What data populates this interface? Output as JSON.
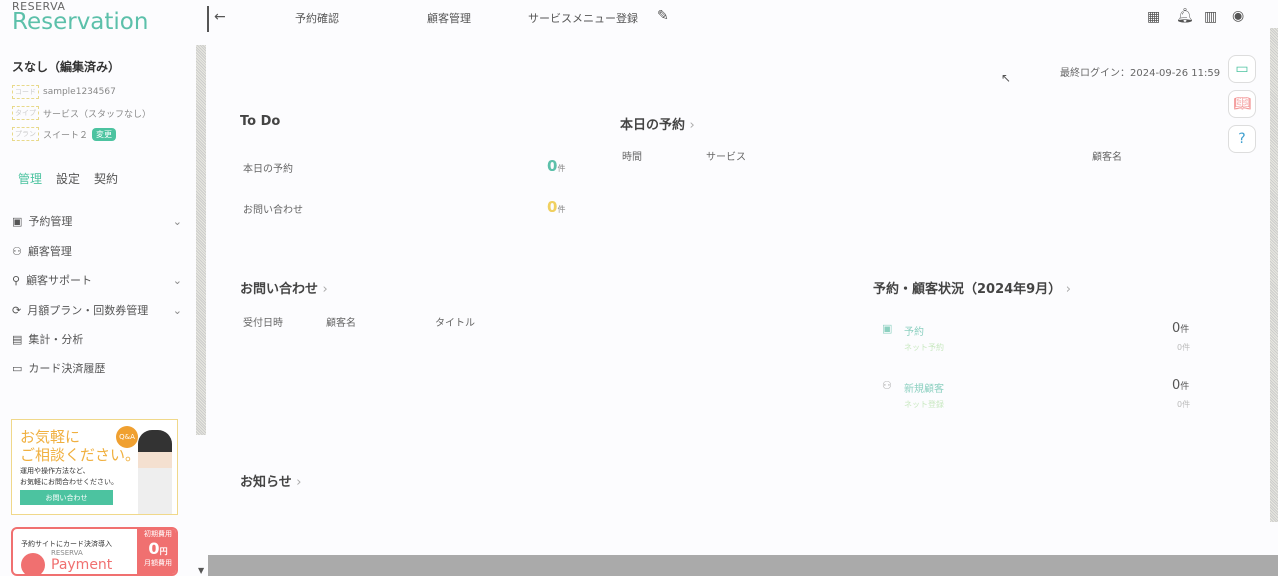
{
  "logo": {
    "brand": "RESERVA",
    "product": "Reservation"
  },
  "shop": {
    "name": "スなし（編集済み）",
    "code_tag": "コード",
    "code": "sample1234567",
    "type_tag": "タイプ",
    "type": "サービス（スタッフなし）",
    "plan_tag": "プラン",
    "plan": "スイート２",
    "change": "変更"
  },
  "sidebar": {
    "tabs": [
      "管理",
      "設定",
      "契約"
    ],
    "items": [
      {
        "label": "予約管理",
        "icon": "calendar-icon",
        "expand": true
      },
      {
        "label": "顧客管理",
        "icon": "users-icon",
        "expand": false
      },
      {
        "label": "顧客サポート",
        "icon": "user-plus-icon",
        "expand": true
      },
      {
        "label": "月額プラン・回数券管理",
        "icon": "repeat-icon",
        "expand": true
      },
      {
        "label": "集計・分析",
        "icon": "chart-icon",
        "expand": false
      },
      {
        "label": "カード決済履歴",
        "icon": "card-icon",
        "expand": false
      }
    ]
  },
  "banner1": {
    "title1": "お気軽に",
    "title2": "ご相談ください。",
    "qa": "Q&A",
    "text1": "運用や操作方法など、",
    "text2": "お気軽にお問合わせください。",
    "button": "お問い合わせ"
  },
  "banner2": {
    "text": "予約サイトにカード決済導入",
    "brand": "RESERVA",
    "product": "Payment",
    "fee1": "初期費用",
    "zero": "0",
    "yen": "円",
    "fee2": "月額費用"
  },
  "topnav": {
    "items": [
      "予約確認",
      "顧客管理",
      "サービスメニュー登録"
    ]
  },
  "last_login": "最終ログイン：2024-09-26 11:59",
  "todo": {
    "title": "To Do",
    "rows": [
      {
        "label": "本日の予約",
        "value": "0",
        "unit": "件"
      },
      {
        "label": "お問い合わせ",
        "value": "0",
        "unit": "件"
      }
    ]
  },
  "today": {
    "title": "本日の予約",
    "cols": [
      "時間",
      "サービス",
      "顧客名"
    ]
  },
  "inquiry": {
    "title": "お問い合わせ",
    "cols": [
      "受付日時",
      "顧客名",
      "タイトル"
    ]
  },
  "status": {
    "title": "予約・顧客状況（2024年9月）",
    "rows": [
      {
        "label": "予約",
        "sub": "ネット予約",
        "value": "0",
        "unit": "件",
        "sub_value": "0件"
      },
      {
        "label": "新規顧客",
        "sub": "ネット登録",
        "value": "0",
        "unit": "件",
        "sub_value": "0件"
      }
    ]
  },
  "news": {
    "title": "お知らせ"
  },
  "colors": {
    "accent": "#4cc3a0",
    "todo_zero1": "#5cc0aa",
    "todo_zero2": "#f0d060"
  }
}
